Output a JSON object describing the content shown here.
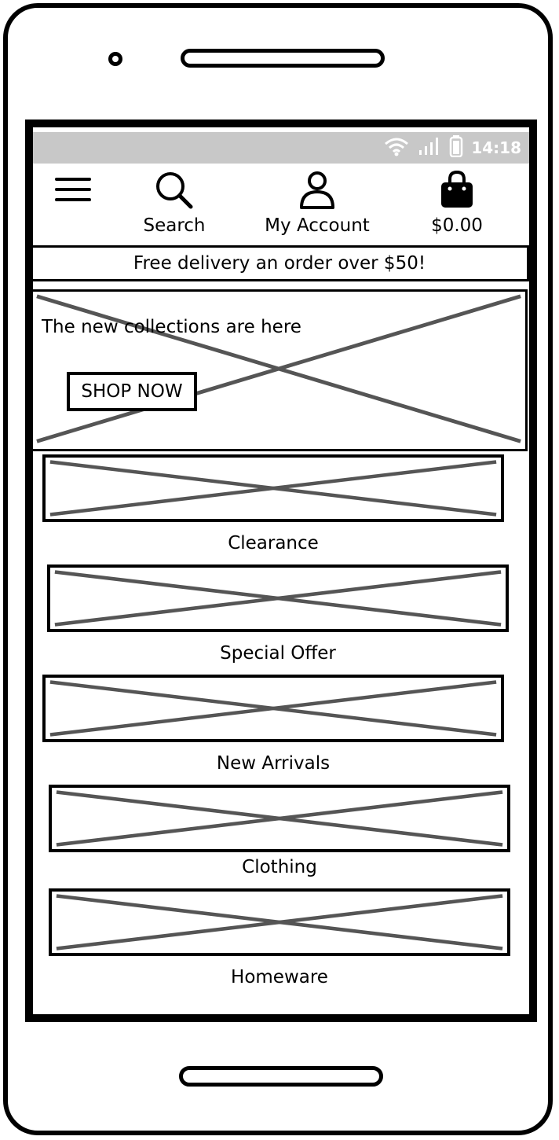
{
  "status_bar": {
    "time": "14:18",
    "icons": [
      "wifi-icon",
      "signal-icon",
      "battery-icon"
    ]
  },
  "header": {
    "menu_icon": "hamburger-menu-icon",
    "search": {
      "label": "Search",
      "icon": "search-icon"
    },
    "account": {
      "label": "My Account",
      "icon": "user-icon"
    },
    "cart": {
      "label": "$0.00",
      "icon": "shopping-bag-icon"
    }
  },
  "promo": {
    "text": "Free delivery an order over $50!"
  },
  "hero": {
    "title": "The new collections are here",
    "button_label": "SHOP NOW"
  },
  "categories": [
    {
      "label": "Clearance"
    },
    {
      "label": "Special Offer"
    },
    {
      "label": "New Arrivals"
    },
    {
      "label": "Clothing"
    },
    {
      "label": "Homeware"
    }
  ],
  "colors": {
    "status_bar": "#c8c8c8",
    "placeholder_x": "#555555",
    "outline": "#000000"
  }
}
